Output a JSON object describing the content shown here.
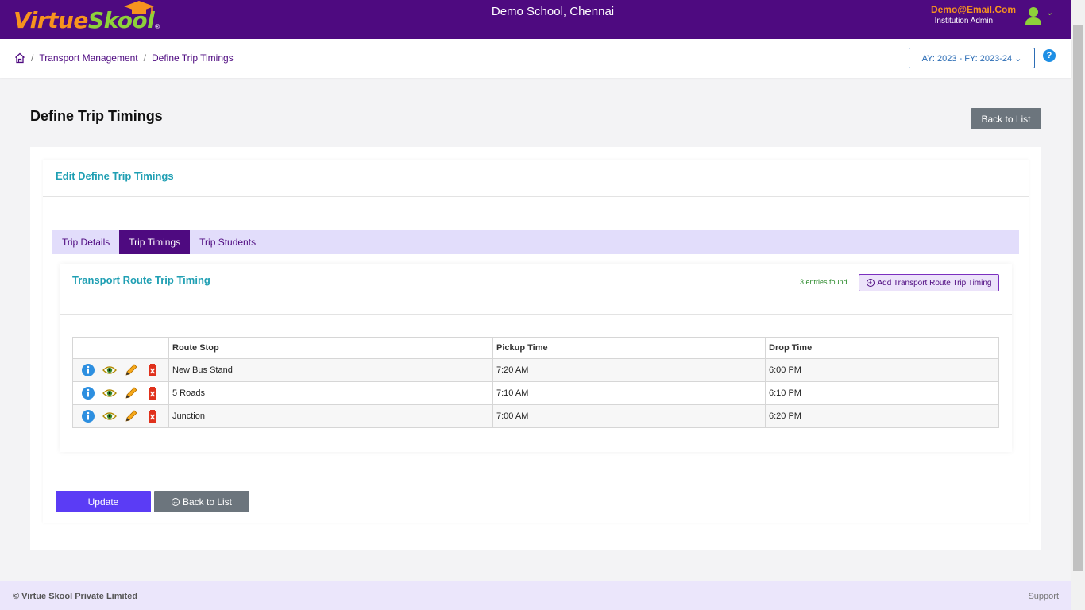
{
  "header": {
    "logo_part1": "Virtue",
    "logo_part2": "Skool",
    "logo_reg": "®",
    "school_name": "Demo School, Chennai",
    "user_email": "Demo@Email.Com",
    "user_role": "Institution Admin",
    "caret": "⌄"
  },
  "breadcrumb": {
    "sep": "/",
    "items": [
      "Transport Management",
      "Define Trip Timings"
    ]
  },
  "year_select": "AY: 2023 - FY: 2023-24  ⌄",
  "help": "?",
  "page": {
    "title": "Define Trip Timings",
    "back_label": "Back to List"
  },
  "card": {
    "title": "Edit Define Trip Timings",
    "tabs": [
      {
        "label": "Trip Details"
      },
      {
        "label": "Trip Timings"
      },
      {
        "label": "Trip Students"
      }
    ],
    "active_tab": "Trip Timings"
  },
  "subcard": {
    "title": "Transport Route Trip Timing",
    "entries": "3 entries found.",
    "add_label": "Add Transport Route Trip Timing",
    "add_icon": "+"
  },
  "table": {
    "headers": [
      "",
      "Route Stop",
      "Pickup Time",
      "Drop Time"
    ],
    "rows": [
      {
        "stop": "New Bus Stand",
        "pickup": "7:20 AM",
        "drop": "6:00 PM"
      },
      {
        "stop": "5 Roads",
        "pickup": "7:10 AM",
        "drop": "6:10 PM"
      },
      {
        "stop": "Junction",
        "pickup": "7:00 AM",
        "drop": "6:20 PM"
      }
    ],
    "row_icons": [
      "info-icon",
      "view-eye-icon",
      "edit-pencil-icon",
      "delete-bin-icon"
    ]
  },
  "actions": {
    "update_label": "Update",
    "back_label": "Back to List",
    "back_icon": "←"
  },
  "footer": {
    "copyright": "© Virtue Skool Private Limited",
    "support": "Support"
  },
  "colors": {
    "brand_purple": "#4e0a80",
    "logo_orange": "#f7931e",
    "logo_green": "#8ed13a",
    "accent_teal": "#1f9fb3",
    "update_button": "#5b3cf5",
    "secondary_gray": "#6c757d"
  }
}
